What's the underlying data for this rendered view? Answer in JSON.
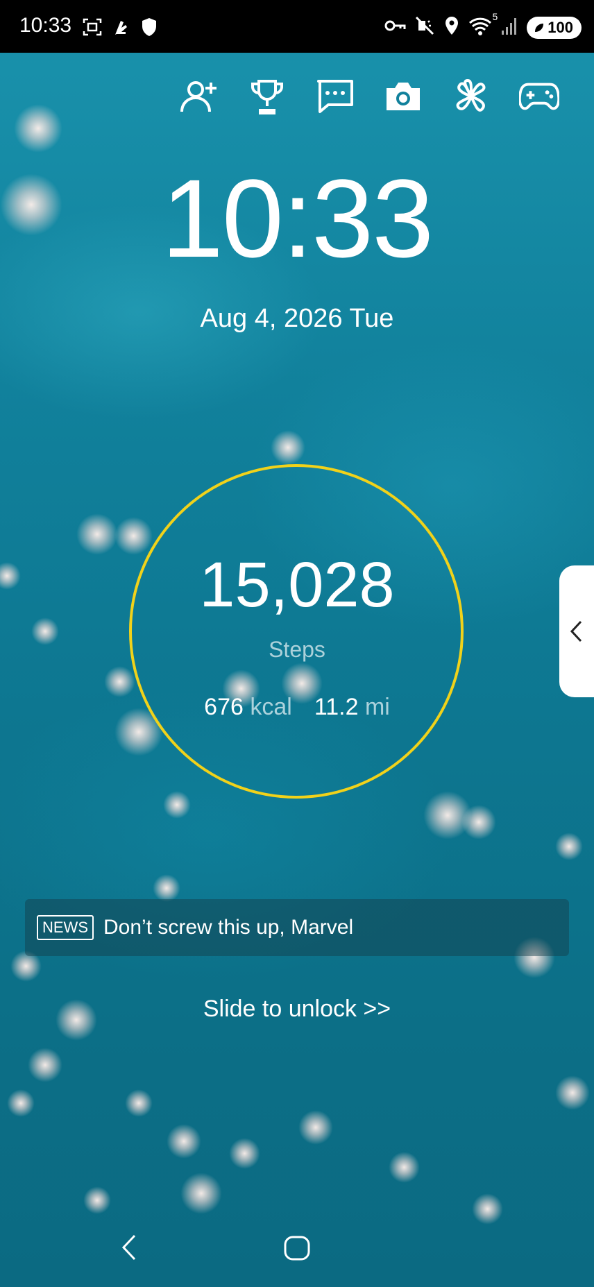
{
  "status_bar": {
    "time": "10:33",
    "battery": "100",
    "left_icons": [
      "screenshot-icon",
      "app-icon",
      "shield-icon"
    ],
    "right_icons": [
      "vpn-key-icon",
      "mute-icon",
      "location-icon",
      "wifi-icon",
      "signal-icon"
    ],
    "wifi_label": "5"
  },
  "shortcuts": [
    "add-friend-icon",
    "trophy-icon",
    "chat-icon",
    "camera-icon",
    "clover-icon",
    "gamepad-icon"
  ],
  "lock_screen": {
    "clock": "10:33",
    "date": "Aug 4, 2026 Tue"
  },
  "pedometer": {
    "steps": "15,028",
    "steps_label": "Steps",
    "kcal_value": "676",
    "kcal_unit": "kcal",
    "distance_value": "11.2",
    "distance_unit": "mi",
    "ring_color": "#f1d21a"
  },
  "news": {
    "badge": "NEWS",
    "headline": "Don’t screw this up, Marvel"
  },
  "unlock_text": "Slide to unlock >>"
}
